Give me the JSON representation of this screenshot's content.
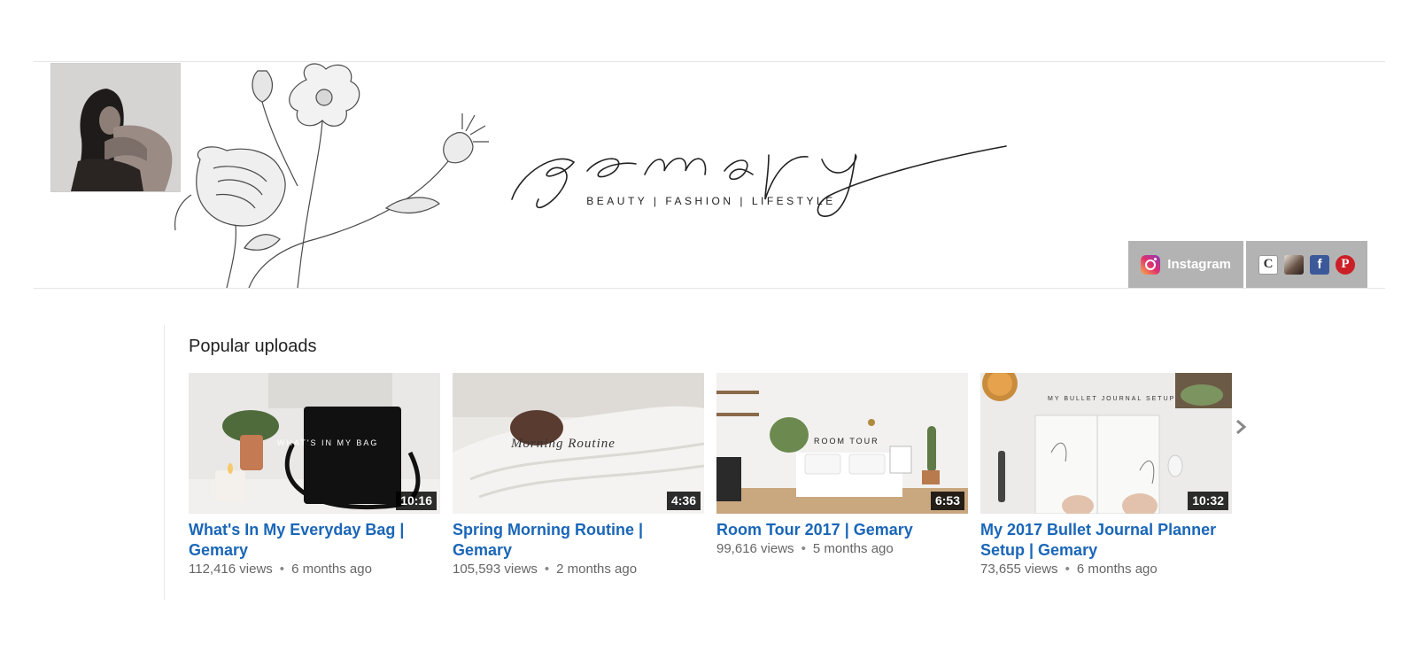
{
  "banner": {
    "brand_name": "gemary",
    "tagline": "BEAUTY | FASHION | LIFESTYLE",
    "links": {
      "instagram_label": "Instagram",
      "instagram_icon": "instagram-icon",
      "other_icons": [
        "website-icon",
        "profile-icon",
        "facebook-icon",
        "pinterest-icon"
      ]
    }
  },
  "section": {
    "title": "Popular uploads",
    "videos": [
      {
        "overlay": "WHAT'S IN MY BAG",
        "duration": "10:16",
        "title": "What's In My Everyday Bag | Gemary",
        "views": "112,416 views",
        "age": "6 months ago"
      },
      {
        "overlay": "Morning Routine",
        "duration": "4:36",
        "title": "Spring Morning Routine | Gemary",
        "views": "105,593 views",
        "age": "2 months ago"
      },
      {
        "overlay": "ROOM TOUR",
        "duration": "6:53",
        "title": "Room Tour 2017 | Gemary",
        "views": "99,616 views",
        "age": "5 months ago"
      },
      {
        "overlay": "MY BULLET JOURNAL SETUP",
        "duration": "10:32",
        "title": "My 2017 Bullet Journal Planner Setup | Gemary",
        "views": "73,655 views",
        "age": "6 months ago"
      }
    ],
    "separator": "•"
  },
  "colors": {
    "link_blue": "#1a66b8",
    "meta_gray": "#666666",
    "link_box_gray": "#969696"
  }
}
